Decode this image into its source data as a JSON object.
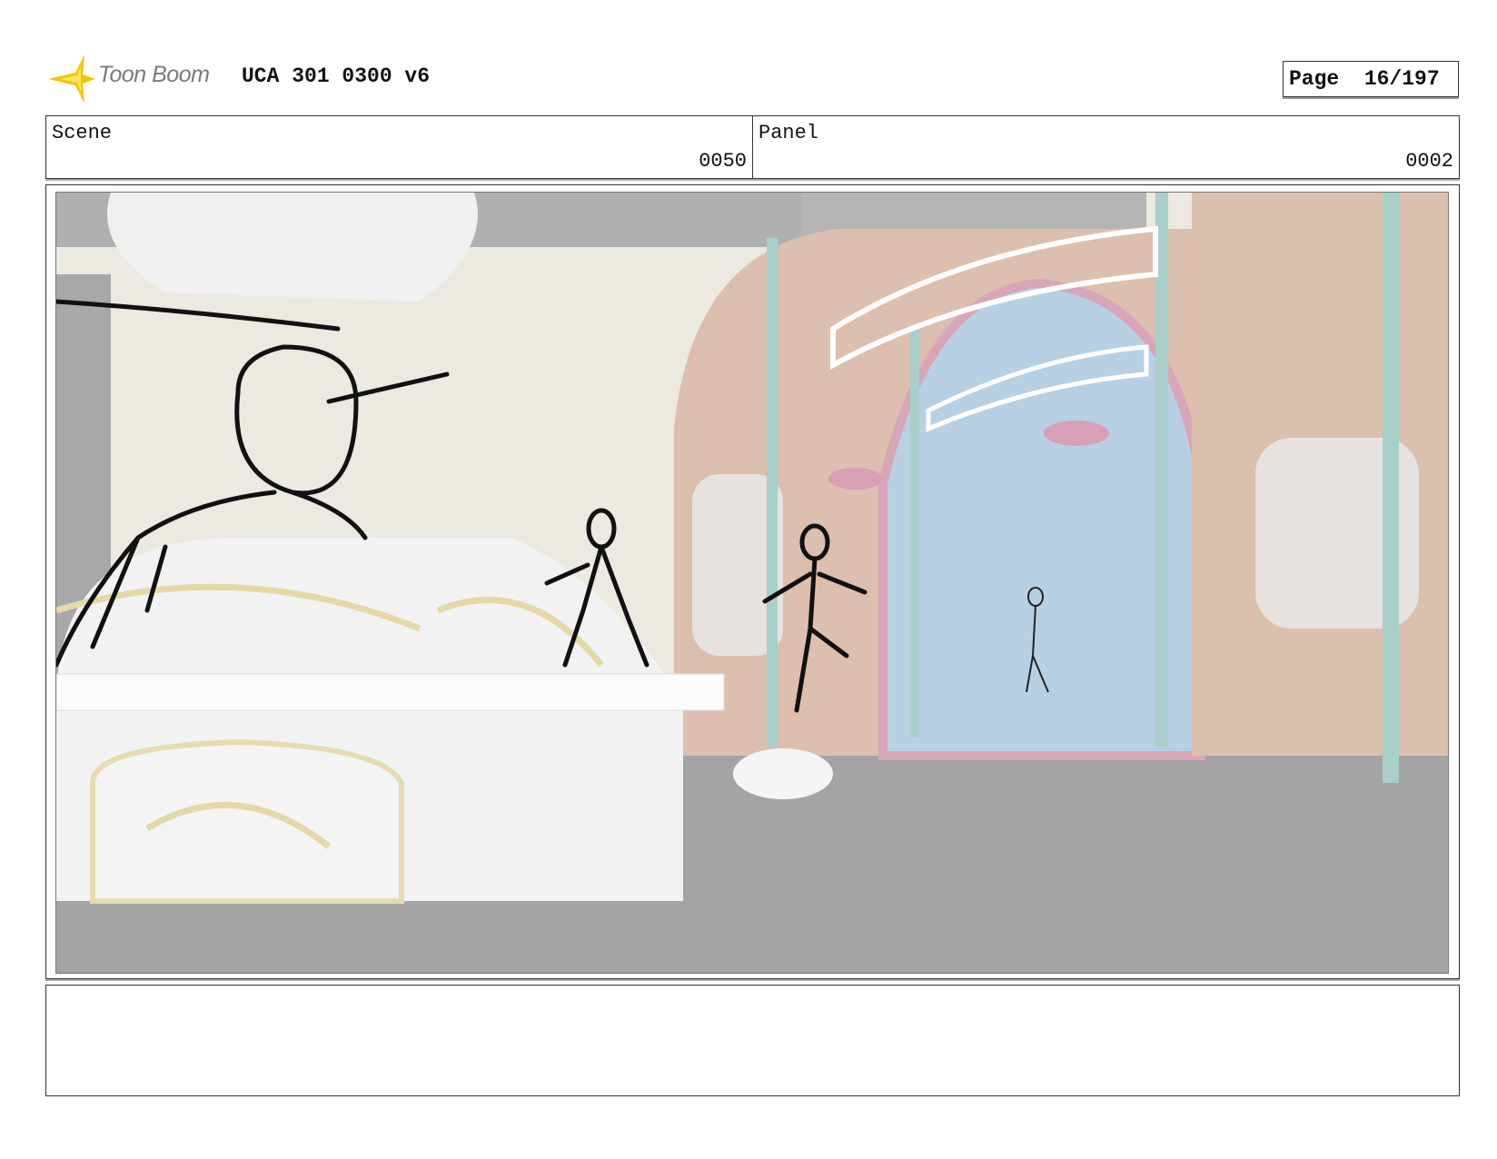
{
  "header": {
    "logo_text": "Toon Boom",
    "project_title": "UCA 301 0300 v6",
    "page_label": "Page",
    "page_value": "16/197"
  },
  "info": {
    "scene_label": "Scene",
    "scene_value": "0050",
    "panel_label": "Panel",
    "panel_value": "0002"
  },
  "notes": {
    "text": ""
  }
}
